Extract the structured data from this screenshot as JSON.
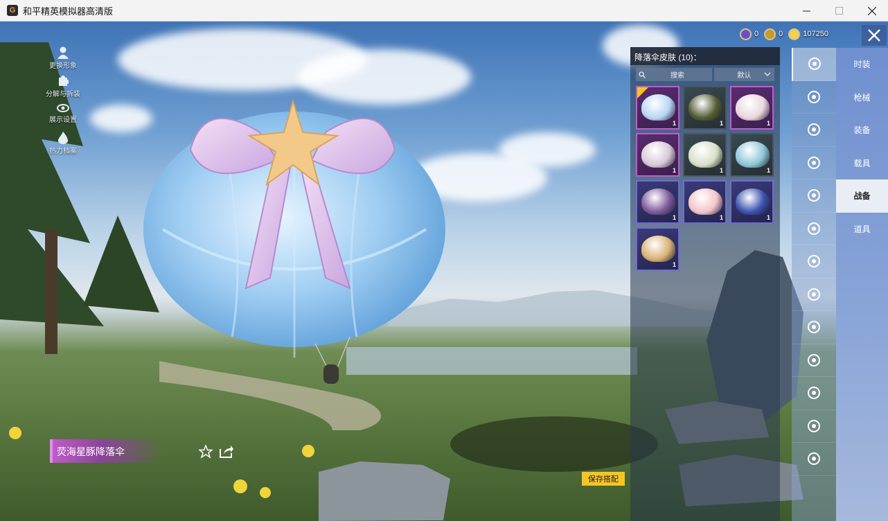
{
  "window": {
    "title": "和平精英模拟器高清版"
  },
  "left_menu": [
    {
      "label": "更换形象",
      "icon": "person-icon"
    },
    {
      "label": "分解与拆装",
      "icon": "puzzle-icon"
    },
    {
      "label": "展示设置",
      "icon": "eye-icon"
    },
    {
      "label": "热力档案",
      "icon": "flame-icon"
    }
  ],
  "currency": [
    {
      "value": "0",
      "icon": "coin-purple-icon",
      "color": "#6a4fc8"
    },
    {
      "value": "0",
      "icon": "coin-gold-ring-icon",
      "color": "#c79a2b"
    },
    {
      "value": "107250",
      "icon": "coin-yellow-icon",
      "color": "#f1d24a"
    }
  ],
  "skin_panel": {
    "header": "降落伞皮肤 (10)：",
    "search_label": "搜索",
    "sort_label": "默认",
    "items": [
      {
        "rarity": "purple",
        "count": "1",
        "selected": true,
        "color": "#b9d6f4"
      },
      {
        "rarity": "grey",
        "count": "1",
        "selected": false,
        "color": "#545c36"
      },
      {
        "rarity": "purple",
        "count": "1",
        "selected": false,
        "color": "#e9d7dd"
      },
      {
        "rarity": "purple",
        "count": "1",
        "selected": false,
        "color": "#d9c9d8"
      },
      {
        "rarity": "grey",
        "count": "1",
        "selected": false,
        "color": "#d8e0c9"
      },
      {
        "rarity": "grey",
        "count": "1",
        "selected": false,
        "color": "#8ec7d8"
      },
      {
        "rarity": "blue",
        "count": "1",
        "selected": false,
        "color": "#7d5a9a"
      },
      {
        "rarity": "blue",
        "count": "1",
        "selected": false,
        "color": "#f2c5c9"
      },
      {
        "rarity": "blue",
        "count": "1",
        "selected": false,
        "color": "#3b52b0"
      },
      {
        "rarity": "blue",
        "count": "1",
        "selected": false,
        "color": "#d8b275"
      }
    ]
  },
  "rail_icons": [
    "parachute-icon",
    "boat-icon",
    "drone-icon",
    "plane-icon",
    "emote-icon",
    "robot-icon",
    "speaker-icon",
    "badge-icon",
    "photo-icon",
    "spray-icon",
    "hand-icon",
    "sparkle-icon",
    "ufo-icon"
  ],
  "categories": [
    {
      "label": "时装",
      "active": false
    },
    {
      "label": "枪械",
      "active": false
    },
    {
      "label": "装备",
      "active": false
    },
    {
      "label": "载具",
      "active": false
    },
    {
      "label": "战备",
      "active": true
    },
    {
      "label": "道具",
      "active": false
    }
  ],
  "item_name": "荧海星豚降落伞",
  "save_label": "保存搭配"
}
